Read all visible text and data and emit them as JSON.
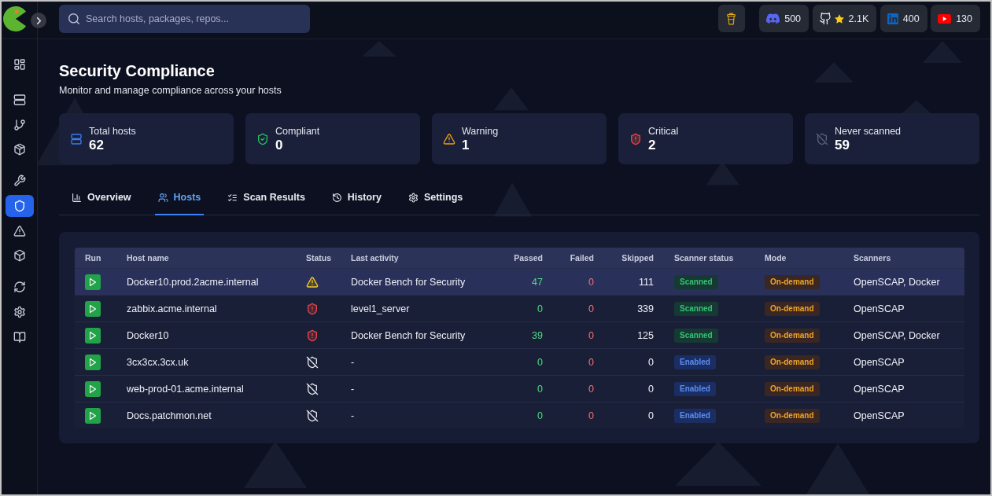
{
  "search": {
    "placeholder": "Search hosts, packages, repos..."
  },
  "sidebar": {
    "groups": [
      {
        "items": [
          {
            "selected": false
          }
        ]
      },
      {
        "items": [
          {
            "selected": false
          },
          {
            "selected": false
          },
          {
            "selected": false
          }
        ]
      },
      {
        "items": [
          {
            "selected": false
          },
          {
            "selected": true
          },
          {
            "selected": false
          },
          {
            "selected": false
          }
        ]
      },
      {
        "items": [
          {
            "selected": false
          },
          {
            "selected": false
          },
          {
            "selected": false
          }
        ]
      }
    ]
  },
  "social": [
    {
      "kind": "discord",
      "count": "500"
    },
    {
      "kind": "github",
      "count": "2.1K"
    },
    {
      "kind": "linkedin",
      "count": "400"
    },
    {
      "kind": "youtube",
      "count": "130"
    }
  ],
  "page": {
    "title": "Security Compliance",
    "subtitle": "Monitor and manage compliance across your hosts"
  },
  "stats": [
    {
      "kind": "total",
      "label": "Total hosts",
      "value": "62"
    },
    {
      "kind": "compliant",
      "label": "Compliant",
      "value": "0"
    },
    {
      "kind": "warning",
      "label": "Warning",
      "value": "1"
    },
    {
      "kind": "critical",
      "label": "Critical",
      "value": "2"
    },
    {
      "kind": "never",
      "label": "Never scanned",
      "value": "59"
    }
  ],
  "tabs": [
    {
      "label": "Overview",
      "selected": false
    },
    {
      "label": "Hosts",
      "selected": true
    },
    {
      "label": "Scan Results",
      "selected": false
    },
    {
      "label": "History",
      "selected": false
    },
    {
      "label": "Settings",
      "selected": false
    }
  ],
  "table": {
    "columns": [
      "Run",
      "Host name",
      "Status",
      "Last activity",
      "Passed",
      "Failed",
      "Skipped",
      "Scanner status",
      "Mode",
      "Scanners"
    ],
    "rows": [
      {
        "selected": true,
        "host": "Docker10.prod.2acme.internal",
        "status_icon": {
          "kind": "warning"
        },
        "last_activity": "Docker Bench for Security",
        "passed": "47",
        "failed": "0",
        "skipped": "111",
        "scanner_status": {
          "kind": "scanned",
          "label": "Scanned"
        },
        "mode": {
          "kind": "on_demand",
          "label": "On-demand"
        },
        "scanners": "OpenSCAP, Docker"
      },
      {
        "selected": false,
        "host": "zabbix.acme.internal",
        "status_icon": {
          "kind": "critical"
        },
        "last_activity": "level1_server",
        "passed": "0",
        "failed": "0",
        "skipped": "339",
        "scanner_status": {
          "kind": "scanned",
          "label": "Scanned"
        },
        "mode": {
          "kind": "on_demand",
          "label": "On-demand"
        },
        "scanners": "OpenSCAP"
      },
      {
        "selected": false,
        "host": "Docker10",
        "status_icon": {
          "kind": "critical"
        },
        "last_activity": "Docker Bench for Security",
        "passed": "39",
        "failed": "0",
        "skipped": "125",
        "scanner_status": {
          "kind": "scanned",
          "label": "Scanned"
        },
        "mode": {
          "kind": "on_demand",
          "label": "On-demand"
        },
        "scanners": "OpenSCAP, Docker"
      },
      {
        "selected": false,
        "host": "3cx3cx.3cx.uk",
        "status_icon": {
          "kind": "never"
        },
        "last_activity": "-",
        "passed": "0",
        "failed": "0",
        "skipped": "0",
        "scanner_status": {
          "kind": "enabled",
          "label": "Enabled"
        },
        "mode": {
          "kind": "on_demand",
          "label": "On-demand"
        },
        "scanners": "OpenSCAP"
      },
      {
        "selected": false,
        "host": "web-prod-01.acme.internal",
        "status_icon": {
          "kind": "never"
        },
        "last_activity": "-",
        "passed": "0",
        "failed": "0",
        "skipped": "0",
        "scanner_status": {
          "kind": "enabled",
          "label": "Enabled"
        },
        "mode": {
          "kind": "on_demand",
          "label": "On-demand"
        },
        "scanners": "OpenSCAP"
      },
      {
        "selected": false,
        "host": "Docs.patchmon.net",
        "status_icon": {
          "kind": "never"
        },
        "last_activity": "-",
        "passed": "0",
        "failed": "0",
        "skipped": "0",
        "scanner_status": {
          "kind": "enabled",
          "label": "Enabled"
        },
        "mode": {
          "kind": "on_demand",
          "label": "On-demand"
        },
        "scanners": "OpenSCAP"
      }
    ]
  }
}
